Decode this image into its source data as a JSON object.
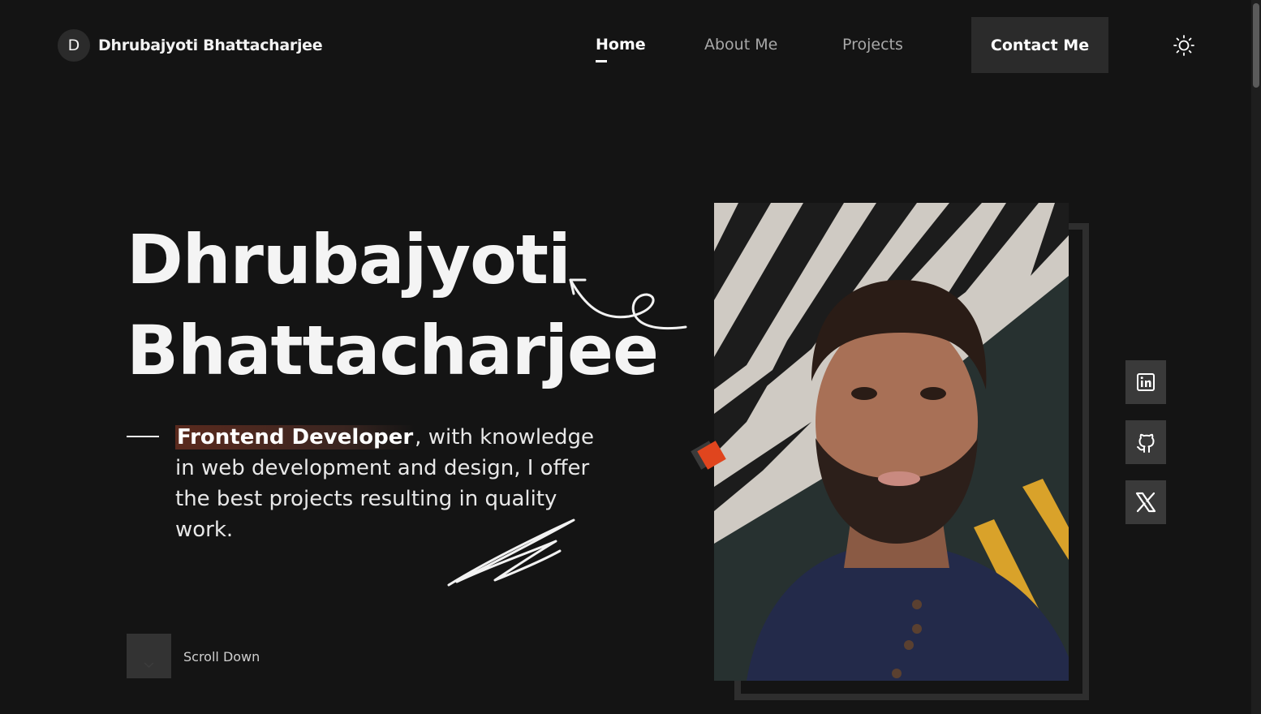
{
  "header": {
    "logo_letter": "D",
    "logo_text": "Dhrubajyoti Bhattacharjee",
    "nav": [
      {
        "label": "Home",
        "active": true
      },
      {
        "label": "About Me",
        "active": false
      },
      {
        "label": "Projects",
        "active": false
      }
    ],
    "contact_label": "Contact Me",
    "theme_icon": "sun-icon"
  },
  "hero": {
    "name_line1": "Dhrubajyoti",
    "name_line2": "Bhattacharjee",
    "role": "Frontend Developer",
    "description": ", with knowledge in web development and design, I offer the best projects resulting in quality work.",
    "scroll_label": "Scroll Down"
  },
  "social": [
    {
      "name": "linkedin-icon"
    },
    {
      "name": "github-icon"
    },
    {
      "name": "x-icon"
    }
  ],
  "colors": {
    "background": "#141414",
    "accent": "#e0451e",
    "button": "#2b2b2b"
  }
}
